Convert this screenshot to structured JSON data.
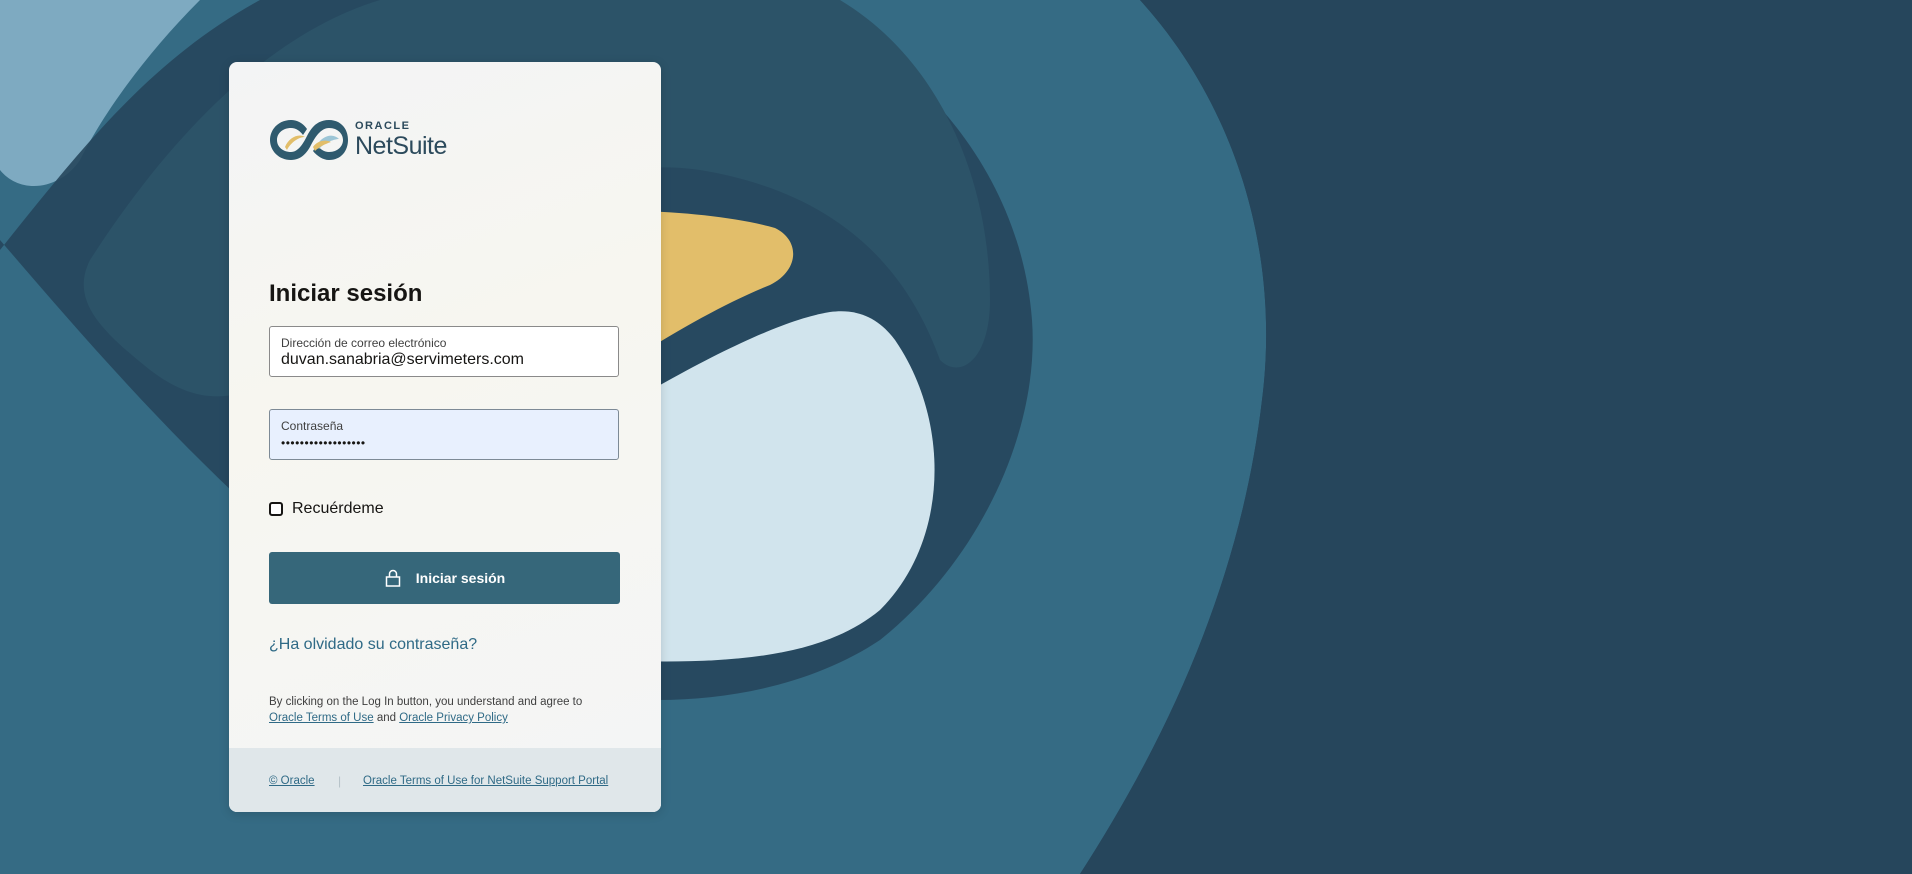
{
  "brand": {
    "oracle": "ORACLE",
    "netsuite": "NetSuite"
  },
  "login": {
    "title": "Iniciar sesión",
    "email_label": "Dirección de correo electrónico",
    "email_value": "duvan.sanabria@servimeters.com",
    "password_label": "Contraseña",
    "password_value": "••••••••••••••••••",
    "remember_label": "Recuérdeme",
    "remember_checked": false,
    "submit_label": "Iniciar sesión",
    "forgot_link": "¿Ha olvidado su contraseña?"
  },
  "legal": {
    "text_before": "By clicking on the Log In button, you understand and agree to",
    "terms_link": "Oracle Terms of Use",
    "and_text": "and",
    "privacy_link": "Oracle Privacy Policy"
  },
  "footer": {
    "copyright_link": "© Oracle",
    "separator": "|",
    "support_terms_link": "Oracle Terms of Use for NetSuite Support Portal"
  },
  "colors": {
    "background": "#26465c",
    "button": "#36677a",
    "link": "#2f6a86",
    "accent_yellow": "#e2be6a",
    "accent_light_blue": "#d1e4ed"
  }
}
